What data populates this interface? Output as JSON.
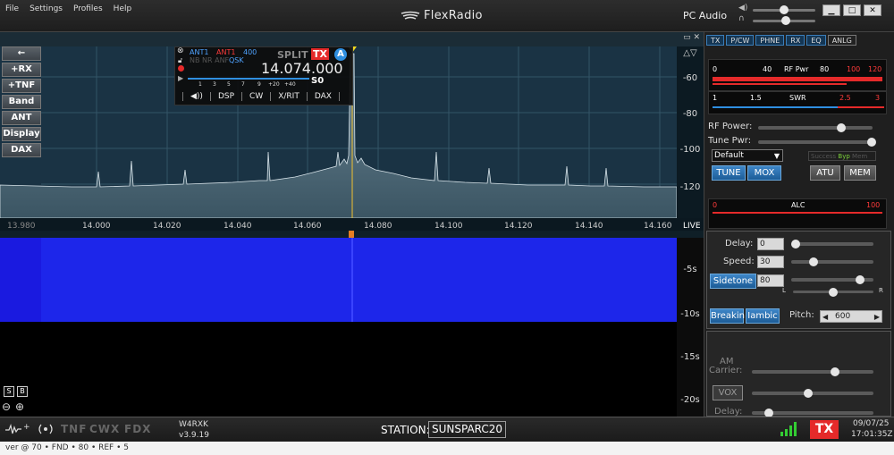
{
  "menu": [
    "File",
    "Settings",
    "Profiles",
    "Help"
  ],
  "app_logo": "FlexRadio",
  "pc_audio_label": "PC Audio",
  "window_buttons": [
    "▁",
    "□",
    "✕"
  ],
  "left_buttons": [
    "←",
    "+RX",
    "+TNF",
    "Band",
    "ANT",
    "Display",
    "DAX"
  ],
  "small_buttons": [
    "S",
    "B"
  ],
  "flag": {
    "ant_rx": "ANT1",
    "ant_tx": "ANT1",
    "filter": "400",
    "options": "NB NR ANF",
    "qsk": "QSK",
    "split": "SPLIT",
    "tx": "TX",
    "slice_letter": "A",
    "frequency": "14.074.000",
    "s_scale": [
      "1",
      "3",
      "5",
      "7",
      "9",
      "+20",
      "+40"
    ],
    "s_reading": "S0",
    "tabs": [
      "◀))",
      "DSP",
      "CW",
      "X/RIT",
      "DAX"
    ]
  },
  "pan": {
    "dbm_labels": [
      "-60",
      "-80",
      "-100",
      "-120"
    ],
    "freq_labels": [
      "13.980",
      "14.000",
      "14.020",
      "14.040",
      "14.060",
      "14.080",
      "14.100",
      "14.120",
      "14.140",
      "14.160"
    ],
    "live_label": "LIVE",
    "time_labels": [
      "-5s",
      "-10s",
      "-15s",
      "-20s"
    ],
    "close": "▭ ✕",
    "arrows": "△▽"
  },
  "right_panel": {
    "tabs": [
      "TX",
      "P/CW",
      "PHNE",
      "RX",
      "EQ",
      "ANLG"
    ],
    "rfpwr_meter": {
      "label": "RF Pwr",
      "ticks": [
        "0",
        "40",
        "80",
        "100",
        "120"
      ]
    },
    "swr_meter": {
      "label": "SWR",
      "ticks": [
        "1",
        "1.5",
        "2.5",
        "3"
      ]
    },
    "rf_power_label": "RF Power:",
    "tune_pwr_label": "Tune Pwr:",
    "profile_value": "Default",
    "atu_status": [
      "Success",
      "Byp",
      "Mem"
    ],
    "buttons_tx": [
      "TUNE",
      "MOX",
      "ATU",
      "MEM"
    ],
    "alc_meter": {
      "label": "ALC",
      "ticks": [
        "0",
        "100"
      ]
    },
    "delay_label": "Delay:",
    "delay_value": "0",
    "speed_label": "Speed:",
    "speed_value": "30",
    "sidetone_label": "Sidetone",
    "sidetone_value": "80",
    "pan_lr": [
      "L",
      "R"
    ],
    "breakin_label": "Breakin",
    "iambic_label": "Iambic",
    "pitch_label": "Pitch:",
    "pitch_value": "600",
    "am_label": "AM",
    "carrier_label": "Carrier:",
    "vox_label": "VOX",
    "delay2_label": "Delay:"
  },
  "status": {
    "tnf": "TNF",
    "cwx": "CWX",
    "fdx": "FDX",
    "callsign": "W4RXK",
    "version": "v3.9.19",
    "station_label": "STATION:",
    "station_value": "SUNSPARC20",
    "tx": "TX",
    "date": "09/07/25",
    "time": "17:01:35Z"
  },
  "below_text": "ver @ 70 • FND • 80 • REF • 5"
}
